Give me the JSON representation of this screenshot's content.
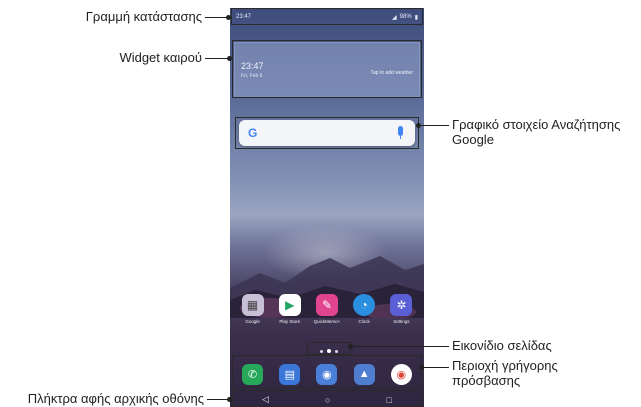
{
  "callouts": {
    "status_bar": "Γραμμή κατάστασης",
    "weather_widget": "Widget καιρού",
    "google_search_widget_line1": "Γραφικό στοιχείο Αναζήτησης",
    "google_search_widget_line2": "Google",
    "page_icon": "Εικονίδιο σελίδας",
    "quick_access_line1": "Περιοχή γρήγορης",
    "quick_access_line2": "πρόσβασης",
    "home_touch_buttons": "Πλήκτρα αφής αρχικής οθόνης"
  },
  "phone": {
    "status": {
      "time": "23:47",
      "battery": "98%"
    },
    "weather": {
      "time": "23:47",
      "date": "Fri, Feb 6",
      "tap_text": "Tap to add weather"
    },
    "search": {
      "logo": "G"
    },
    "apps": [
      {
        "label": "Google",
        "icon": "folder-icon",
        "color": "#c7bfd6"
      },
      {
        "label": "Play Store",
        "icon": "play-store-icon",
        "color": "#ffffff"
      },
      {
        "label": "QuickMemo+",
        "icon": "pencil-icon",
        "color": "#e2458f"
      },
      {
        "label": "Clock",
        "icon": "clock-icon",
        "color": "#2b8fe0"
      },
      {
        "label": "Settings",
        "icon": "gear-icon",
        "color": "#5a5fd6"
      }
    ],
    "quick_access": [
      {
        "icon": "phone-icon",
        "color": "#27a85a"
      },
      {
        "icon": "messaging-icon",
        "color": "#3b77d8"
      },
      {
        "icon": "camera-icon",
        "color": "#4a7fd9"
      },
      {
        "icon": "gallery-icon",
        "color": "#4f7ed1"
      },
      {
        "icon": "chrome-icon",
        "color": "#ffffff"
      }
    ],
    "nav": {
      "back": "◁",
      "home": "○",
      "recents": "□"
    }
  }
}
